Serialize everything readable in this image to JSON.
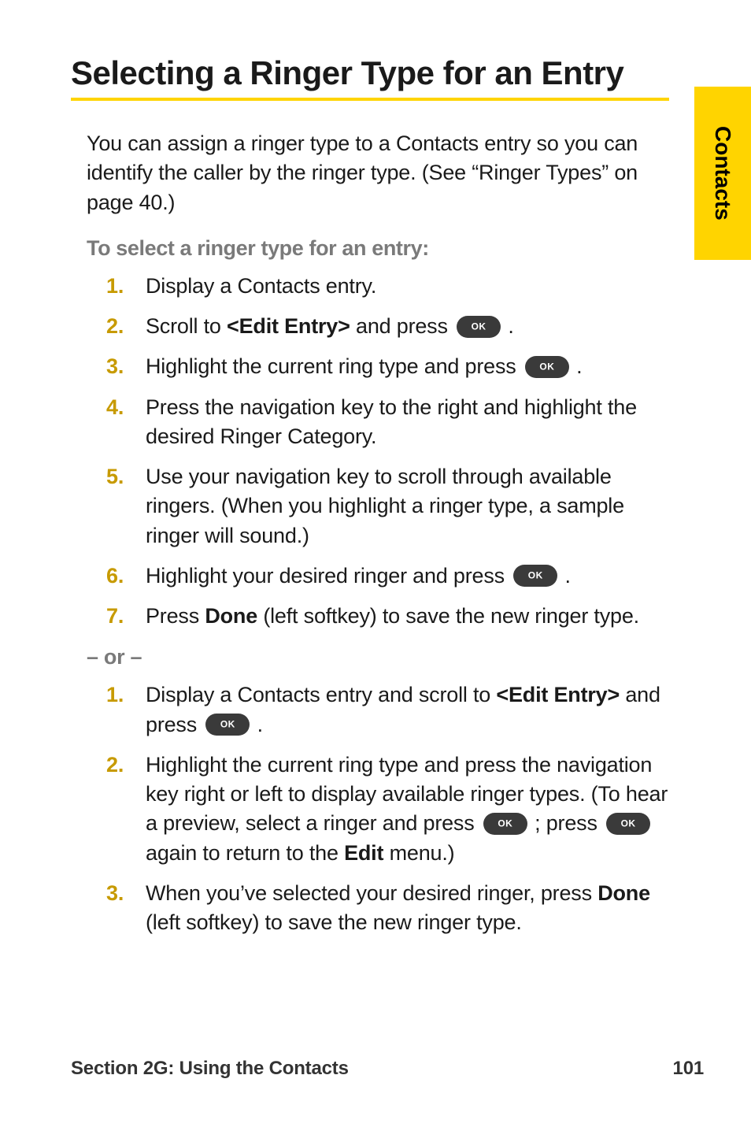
{
  "side_tab": {
    "label": "Contacts"
  },
  "heading": "Selecting a Ringer Type for an Entry",
  "intro": {
    "line1": "You can assign a ringer type to a Contacts entry so you can identify the caller by the ringer type. (See “Ringer Types” on page 40.)"
  },
  "subheading": "To select a ringer type for an entry:",
  "list1": {
    "s1": "Display a Contacts entry.",
    "s2_a": "Scroll to ",
    "s2_bold": "<Edit Entry>",
    "s2_b": " and press ",
    "s2_c": " .",
    "s3_a": "Highlight the current ring type and press ",
    "s3_b": " .",
    "s4": "Press the navigation key to the right and highlight the desired Ringer Category.",
    "s5": "Use your navigation key to scroll through available ringers. (When you highlight a ringer type, a sample ringer will sound.)",
    "s6_a": "Highlight your desired ringer and press ",
    "s6_b": " .",
    "s7_a": "Press ",
    "s7_bold": "Done",
    "s7_b": " (left softkey) to save the new ringer type."
  },
  "or_separator": "– or –",
  "list2": {
    "s1_a": "Display a Contacts entry and scroll to ",
    "s1_bold": "<Edit Entry>",
    "s1_b": " and press ",
    "s1_c": " .",
    "s2_a": "Highlight the current ring type and press the navigation key right or left to display available ringer types. (To hear a preview, select a ringer and press ",
    "s2_b": " ; press ",
    "s2_c": " again to return to the ",
    "s2_bold": "Edit",
    "s2_d": " menu.)",
    "s3_a": "When you’ve selected your desired ringer, press ",
    "s3_bold": "Done",
    "s3_b": " (left softkey) to save the new ringer type."
  },
  "footer": {
    "section": "Section 2G: Using the Contacts",
    "page_number": "101"
  }
}
